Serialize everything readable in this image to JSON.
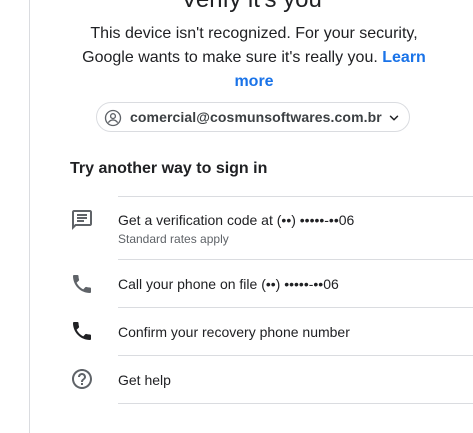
{
  "header": {
    "title": "Verify it's you",
    "description": "This device isn't recognized. For your security, Google wants to make sure it's really you.",
    "learn_more": "Learn more"
  },
  "account": {
    "email": "comercial@cosmunsoftwares.com.br"
  },
  "options_section": {
    "title": "Try another way to sign in",
    "options": [
      {
        "icon": "message-icon",
        "label": "Get a verification code at (••) •••••-••06",
        "sublabel": "Standard rates apply"
      },
      {
        "icon": "phone-icon",
        "label": "Call your phone on file (••) •••••-••06"
      },
      {
        "icon": "phone-icon",
        "label": "Confirm your recovery phone number"
      },
      {
        "icon": "help-circle-icon",
        "label": "Get help"
      }
    ]
  },
  "colors": {
    "link": "#1a73e8",
    "divider": "#dadce0",
    "text": "#202124",
    "secondary_text": "#5f6368",
    "icon": "#5f6368"
  }
}
